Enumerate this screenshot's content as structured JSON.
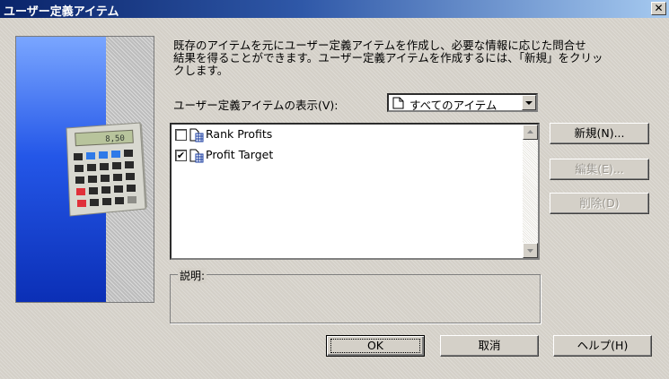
{
  "window": {
    "title": "ユーザー定義アイテム",
    "close_glyph": "✕"
  },
  "intro": {
    "description": "既存のアイテムを元にユーザー定義アイテムを作成し、必要な情報に応じた問合せ\n結果を得ることができます。ユーザー定義アイテムを作成するには、「新規」をクリッ\nクします。"
  },
  "calculator": {
    "display": "8,50"
  },
  "view": {
    "label": "ユーザー定義アイテムの表示(V):",
    "selected": "すべてのアイテム",
    "icon": "document-icon"
  },
  "items": [
    {
      "label": "Rank Profits",
      "checked": false,
      "check_glyph": "",
      "icon": "table-item-icon"
    },
    {
      "label": "Profit Target",
      "checked": true,
      "check_glyph": "✔",
      "icon": "table-item-icon"
    }
  ],
  "info": {
    "label": "説明:",
    "text": ""
  },
  "buttons": {
    "new": "新規(N)...",
    "edit": "編集(E)...",
    "delete": "削除(D)",
    "ok": "OK",
    "cancel": "取消",
    "help": "ヘルプ(H)"
  },
  "colors": {
    "titlebar": "#0a246a",
    "dialog_face": "#d4d0c8",
    "banner_blue": "#2457e8"
  }
}
